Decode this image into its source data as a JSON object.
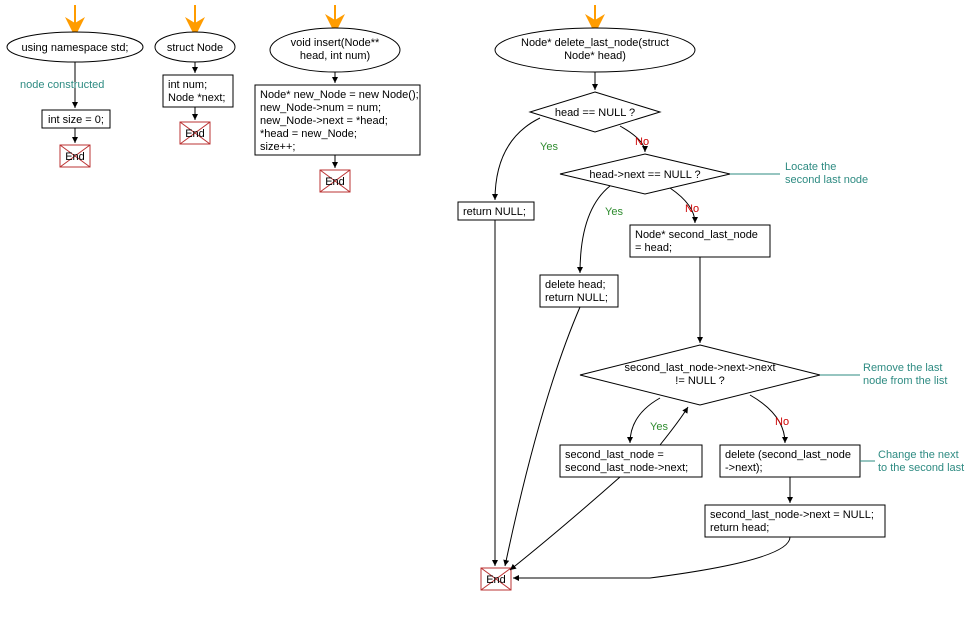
{
  "col1": {
    "ellipse": "using namespace std;",
    "comment": "node constructed",
    "box": "int size = 0;",
    "end": "End"
  },
  "col2": {
    "ellipse": "struct Node",
    "box_l1": "int num;",
    "box_l2": "Node *next;",
    "end": "End"
  },
  "col3": {
    "ellipse_l1": "void insert(Node**",
    "ellipse_l2": "head, int num)",
    "box_l1": "Node* new_Node = new Node();",
    "box_l2": "new_Node->num = num;",
    "box_l3": "new_Node->next = *head;",
    "box_l4": "*head = new_Node;",
    "box_l5": "size++;",
    "end": "End"
  },
  "col4": {
    "ellipse_l1": "Node* delete_last_node(struct",
    "ellipse_l2": "Node* head)",
    "d1": "head == NULL ?",
    "d2": "head->next == NULL ?",
    "box_return_null": "return NULL;",
    "box_sec_init_l1": "Node* second_last_node",
    "box_sec_init_l2": "= head;",
    "box_del_head_l1": "delete head;",
    "box_del_head_l2": "return NULL;",
    "d3_l1": "second_last_node->next->next",
    "d3_l2": "!= NULL ?",
    "box_advance_l1": "second_last_node =",
    "box_advance_l2": "second_last_node->next;",
    "box_delete_next_l1": "delete (second_last_node",
    "box_delete_next_l2": "->next);",
    "box_set_null_l1": "second_last_node->next = NULL;",
    "box_set_null_l2": "return head;",
    "comment_locate_l1": "Locate the",
    "comment_locate_l2": "second last node",
    "comment_remove_l1": "Remove the last",
    "comment_remove_l2": "node from the list",
    "comment_change_l1": "Change the next",
    "comment_change_l2": "to the second last",
    "end": "End",
    "yes": "Yes",
    "no": "No"
  }
}
